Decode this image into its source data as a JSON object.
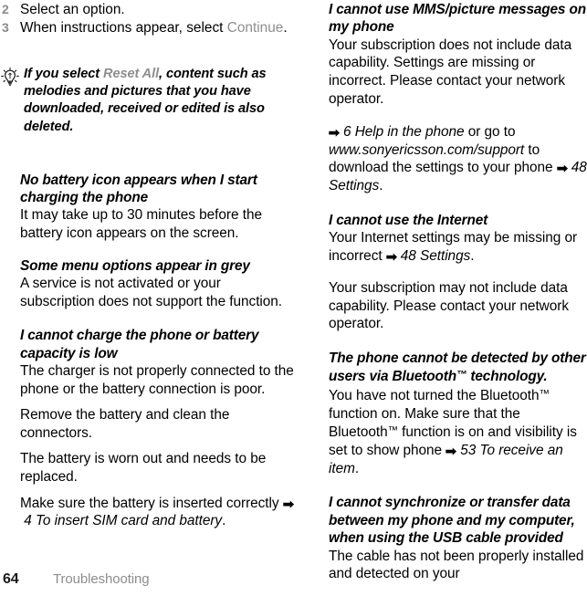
{
  "page": {
    "folio": "64",
    "running_head": "Troubleshooting"
  },
  "left_column": {
    "steps": [
      {
        "num": "2",
        "text": "Select an option."
      },
      {
        "num": "3",
        "text_before": "When instructions appear, select ",
        "emphasis": "Continue",
        "text_after": "."
      }
    ],
    "tip": {
      "icon": "lightbulb-icon",
      "text_before": "If you select ",
      "emphasis": "Reset All",
      "text_after": ", content such as melodies and pictures that you have downloaded, received or edited is also deleted."
    },
    "sections": [
      {
        "heading": "No battery icon appears when I start charging the phone",
        "paragraphs": [
          "It may take up to 30 minutes before the battery icon appears on the screen."
        ]
      },
      {
        "heading": "Some menu options appear in grey",
        "paragraphs": [
          "A service is not activated or your subscription does not support the function."
        ]
      },
      {
        "heading": "I cannot charge the phone or battery capacity is low",
        "paragraphs": [
          "The charger is not properly connected to the phone or the battery connection is poor.",
          "Remove the battery and clean the connectors.",
          "The battery is worn out and needs to be replaced."
        ],
        "last_paragraph": {
          "text_before": "Make sure the battery is inserted correctly ",
          "arrow": "➡",
          "reference": "4 To insert SIM card and battery",
          "text_after": "."
        }
      }
    ]
  },
  "right_column": {
    "sections": [
      {
        "heading": "I cannot use MMS/picture messages on my phone",
        "paragraphs": [
          "Your subscription does not include data capability. Settings are missing or incorrect. Please contact your network operator."
        ],
        "reference_paragraph": {
          "arrow": "➡",
          "reference_1": "6 Help in the phone",
          "mid_1": " or go to ",
          "reference_2": "www.sonyericsson.com/support",
          "mid_2": " to download the settings to your phone ",
          "arrow_2": "➡",
          "reference_3": "48 Settings",
          "tail": "."
        }
      },
      {
        "heading": "I cannot use the Internet",
        "paragraphs_rich": {
          "text_before": "Your Internet settings may be missing or incorrect ",
          "arrow": "➡",
          "reference": "48 Settings",
          "text_after": "."
        },
        "paragraphs": [
          "Your subscription may not include data capability. Please contact your network operator."
        ]
      },
      {
        "heading_parts": {
          "before": "The phone cannot be detected by other users via Bluetooth",
          "tm": "™",
          "after": " technology."
        },
        "body_rich": {
          "p1_before": "You have not turned the Bluetooth",
          "p1_tm": "™",
          "p1_mid": " function on. Make sure that the Bluetooth",
          "p1_tm2": "™",
          "p1_mid2": " function is on and visibility is set to show phone ",
          "p1_arrow": "➡",
          "p1_reference": "53 To receive an item",
          "p1_tail": "."
        }
      },
      {
        "heading": "I cannot synchronize or transfer data between my phone and my computer, when using the USB cable provided",
        "paragraphs": [
          "The cable has not been properly installed and detected on your"
        ]
      }
    ]
  },
  "colors": {
    "text": "#000000",
    "grey_emphasis": "#8e8e8e",
    "grey_step_number": "#8a8a8a",
    "running_head": "#8d8d8d"
  }
}
